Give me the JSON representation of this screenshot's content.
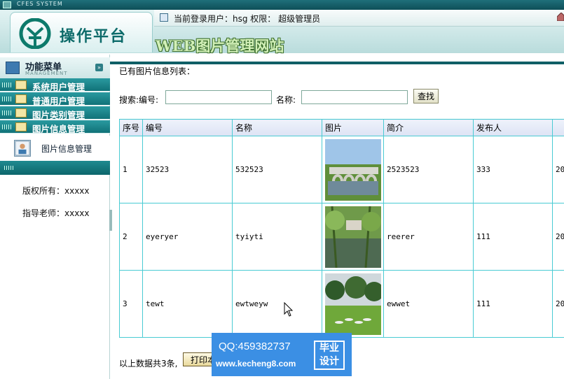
{
  "window": {
    "system_caption": "CFES SYSTEM"
  },
  "header": {
    "logo_text": "操作平台",
    "login_info": "当前登录用户：hsg 权限： 超级管理员",
    "site_title": "WEB图片管理网站"
  },
  "sidebar": {
    "menu_title": "功能菜单",
    "menu_subtitle": "MANAGEMENT",
    "toggle_icon": "»",
    "items": [
      {
        "label": "系统用户管理"
      },
      {
        "label": "普通用户管理"
      },
      {
        "label": "图片类别管理"
      },
      {
        "label": "图片信息管理"
      }
    ],
    "active_submenu": "图片信息管理",
    "copyright": "版权所有：xxxxx",
    "advisor": "指导老师：xxxxx"
  },
  "main": {
    "list_title": "已有图片信息列表：",
    "search": {
      "label_id": "搜索:编号:",
      "id_value": "",
      "label_name": "名称:",
      "name_value": "",
      "button": "查找"
    },
    "table": {
      "columns": [
        "序号",
        "编号",
        "名称",
        "图片",
        "简介",
        "发布人",
        ""
      ],
      "rows": [
        {
          "seq": "1",
          "code": "32523",
          "name": "532523",
          "image": "bridge-photo",
          "intro": "2523523",
          "publisher": "333",
          "extra": "20"
        },
        {
          "seq": "2",
          "code": "eyeryer",
          "name": "tyiyti",
          "image": "pond-photo",
          "intro": "reerer",
          "publisher": "111",
          "extra": "20"
        },
        {
          "seq": "3",
          "code": "tewt",
          "name": "ewtweyw",
          "image": "garden-photo",
          "intro": "ewwet",
          "publisher": "111",
          "extra": "20"
        }
      ]
    },
    "footer": {
      "count_text": "以上数据共3条,",
      "print_button": "打印本"
    }
  },
  "watermark": {
    "qq": "QQ:459382737",
    "url": "www.kecheng8.com",
    "badge_line1": "毕业",
    "badge_line2": "设计"
  },
  "colors": {
    "teal": "#117278",
    "grid_border": "#49cbd3",
    "watermark_blue": "#3b8fe4"
  }
}
